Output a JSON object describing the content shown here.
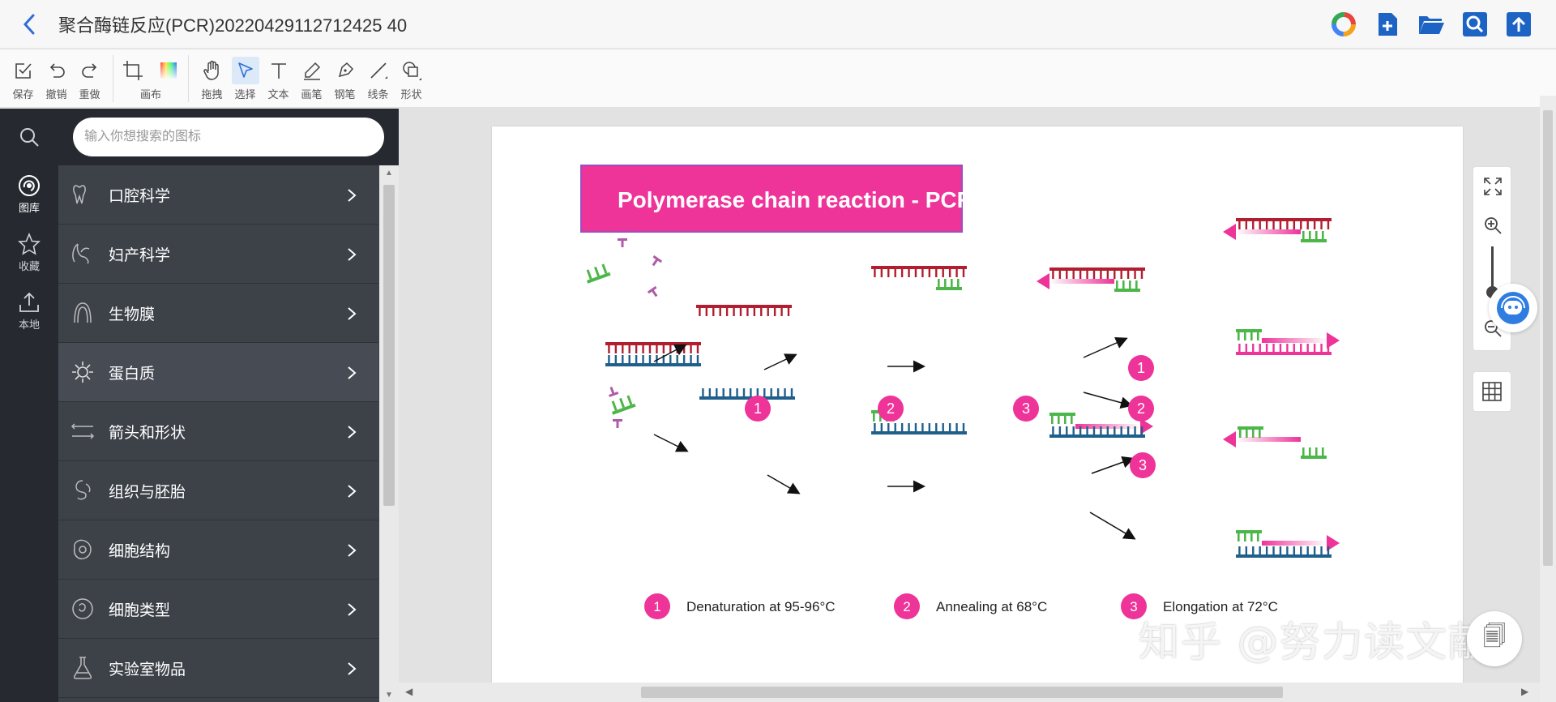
{
  "app": {
    "title": "聚合酶链反应(PCR)20220429112712425 40"
  },
  "toolbar": {
    "save": "保存",
    "undo": "撤销",
    "redo": "重做",
    "canvas": "画布",
    "pan": "拖拽",
    "select": "选择",
    "text": "文本",
    "brush": "画笔",
    "pen": "钢笔",
    "line": "线条",
    "shape": "形状"
  },
  "rail": {
    "gallery": "图库",
    "favorites": "收藏",
    "local": "本地"
  },
  "search": {
    "placeholder": "输入你想搜索的图标"
  },
  "categories": [
    {
      "label": "口腔科学",
      "icon": "tooth-icon"
    },
    {
      "label": "妇产科学",
      "icon": "uterus-icon"
    },
    {
      "label": "生物膜",
      "icon": "membrane-icon"
    },
    {
      "label": "蛋白质",
      "icon": "protein-icon"
    },
    {
      "label": "箭头和形状",
      "icon": "arrows-icon"
    },
    {
      "label": "组织与胚胎",
      "icon": "embryo-icon"
    },
    {
      "label": "细胞结构",
      "icon": "cell-structure-icon"
    },
    {
      "label": "细胞类型",
      "icon": "cell-type-icon"
    },
    {
      "label": "实验室物品",
      "icon": "flask-icon"
    }
  ],
  "diagram": {
    "title": "Polymerase chain reaction - PCR",
    "steps": [
      {
        "num": "1",
        "label": "Denaturation at 95-96°C"
      },
      {
        "num": "2",
        "label": "Annealing at 68°C"
      },
      {
        "num": "3",
        "label": "Elongation at 72°C"
      }
    ],
    "colors": {
      "pink": "#ee3399",
      "red": "#b01e2f",
      "blue": "#1f5f8b",
      "green": "#4cb748",
      "light_pink": "#f5a8cf",
      "purple": "#b05ba8"
    }
  },
  "watermark": "知乎 @努力读文献",
  "corner_button": "🗐"
}
